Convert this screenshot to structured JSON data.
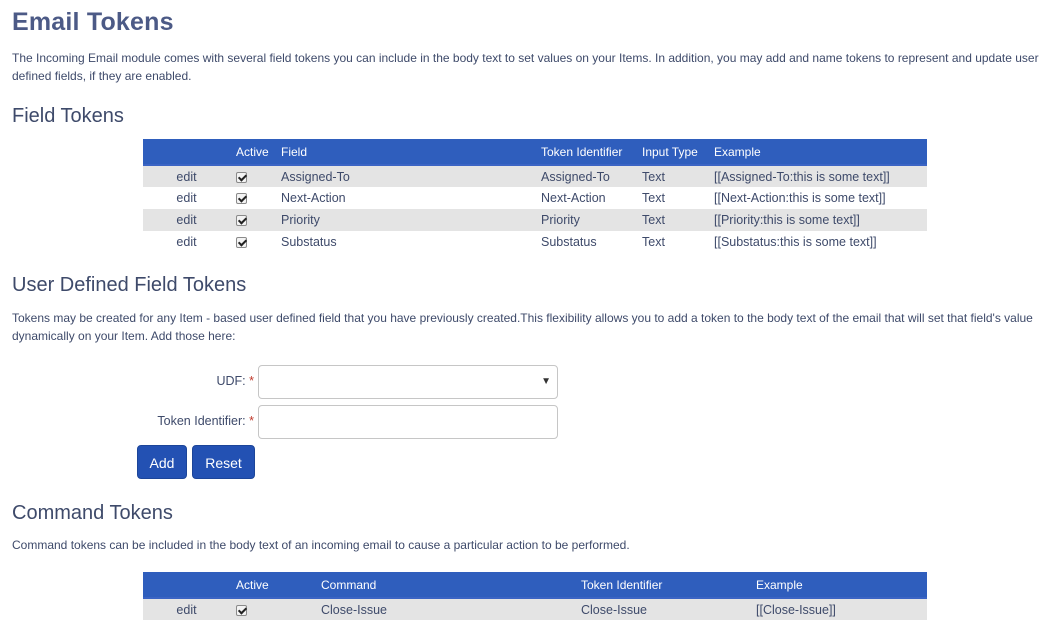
{
  "page": {
    "title": "Email Tokens",
    "intro": "The Incoming Email module comes with several field tokens you can include in the body text to set values on your Items. In addition, you may add and name tokens to represent and update user defined fields, if they are enabled."
  },
  "field_tokens": {
    "heading": "Field Tokens",
    "columns": [
      "",
      "Active",
      "Field",
      "Token Identifier",
      "Input Type",
      "Example"
    ],
    "rows": [
      {
        "action": "edit",
        "active": true,
        "field": "Assigned-To",
        "token": "Assigned-To",
        "input_type": "Text",
        "example": "[[Assigned-To:this is some text]]"
      },
      {
        "action": "edit",
        "active": true,
        "field": "Next-Action",
        "token": "Next-Action",
        "input_type": "Text",
        "example": "[[Next-Action:this is some text]]"
      },
      {
        "action": "edit",
        "active": true,
        "field": "Priority",
        "token": "Priority",
        "input_type": "Text",
        "example": "[[Priority:this is some text]]"
      },
      {
        "action": "edit",
        "active": true,
        "field": "Substatus",
        "token": "Substatus",
        "input_type": "Text",
        "example": "[[Substatus:this is some text]]"
      }
    ]
  },
  "udf_tokens": {
    "heading": "User Defined Field Tokens",
    "description": "Tokens may be created for any Item - based user defined field that you have previously created.This flexibility allows you to add a token to the body text of the email that will set that field's value dynamically on your Item. Add those here:",
    "udf_label": "UDF:",
    "udf_value": "",
    "token_label": "Token Identifier:",
    "token_value": "",
    "required_mark": "*",
    "add_label": "Add",
    "reset_label": "Reset"
  },
  "command_tokens": {
    "heading": "Command Tokens",
    "description": "Command tokens can be included in the body text of an incoming email to cause a particular action to be performed.",
    "columns": [
      "",
      "Active",
      "Command",
      "Token Identifier",
      "Example"
    ],
    "rows": [
      {
        "action": "edit",
        "active": true,
        "command": "Close-Issue",
        "token": "Close-Issue",
        "example": "[[Close-Issue]]"
      }
    ]
  },
  "colors": {
    "header_bg": "#2f5ebd",
    "button_bg": "#2351b3",
    "title": "#4c5a86",
    "row_alt": "#e4e4e4",
    "required": "#c0392b"
  }
}
